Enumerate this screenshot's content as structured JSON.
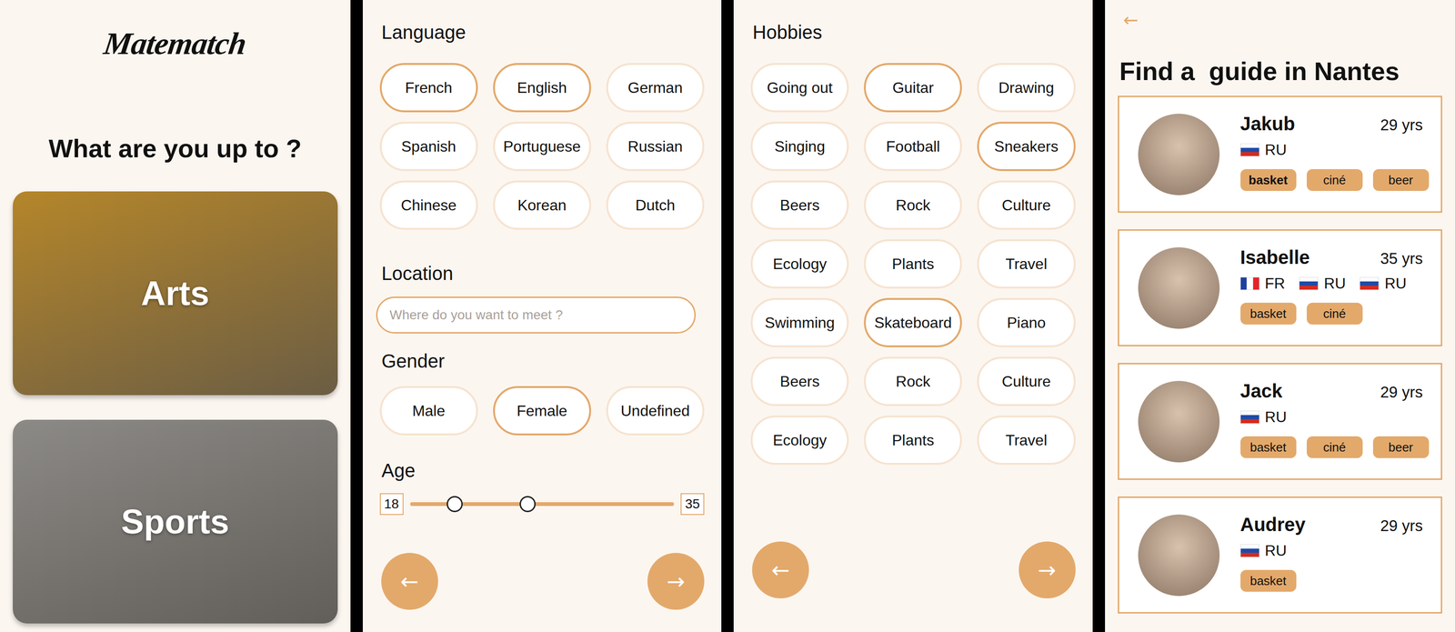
{
  "home": {
    "logo": "Matematch",
    "title": "What are you up to ?",
    "categories": [
      {
        "label": "Arts",
        "color": "#b5862a"
      },
      {
        "label": "Sports",
        "color": "#8c8a86"
      }
    ]
  },
  "filters": {
    "language": {
      "heading": "Language",
      "options": [
        {
          "label": "French",
          "selected": true
        },
        {
          "label": "English",
          "selected": true
        },
        {
          "label": "German",
          "selected": false
        },
        {
          "label": "Spanish",
          "selected": false
        },
        {
          "label": "Portuguese",
          "selected": false
        },
        {
          "label": "Russian",
          "selected": false
        },
        {
          "label": "Chinese",
          "selected": false
        },
        {
          "label": "Korean",
          "selected": false
        },
        {
          "label": "Dutch",
          "selected": false
        }
      ]
    },
    "location": {
      "heading": "Location",
      "placeholder": "Where do you want to meet ?"
    },
    "gender": {
      "heading": "Gender",
      "options": [
        {
          "label": "Male",
          "selected": false
        },
        {
          "label": "Female",
          "selected": true
        },
        {
          "label": "Undefined",
          "selected": false
        }
      ]
    },
    "age": {
      "heading": "Age",
      "min": "18",
      "max": "35",
      "low_level": 0.17,
      "high_level": 0.446
    },
    "nav": {
      "back": "←",
      "next": "→"
    }
  },
  "hobbies": {
    "heading": "Hobbies",
    "options": [
      {
        "label": "Going out",
        "selected": false
      },
      {
        "label": "Guitar",
        "selected": true
      },
      {
        "label": "Drawing",
        "selected": false
      },
      {
        "label": "Singing",
        "selected": false
      },
      {
        "label": "Football",
        "selected": false
      },
      {
        "label": "Sneakers",
        "selected": true
      },
      {
        "label": "Beers",
        "selected": false
      },
      {
        "label": "Rock",
        "selected": false
      },
      {
        "label": "Culture",
        "selected": false
      },
      {
        "label": "Ecology",
        "selected": false
      },
      {
        "label": "Plants",
        "selected": false
      },
      {
        "label": "Travel",
        "selected": false
      },
      {
        "label": "Swimming",
        "selected": false
      },
      {
        "label": "Skateboard",
        "selected": true
      },
      {
        "label": "Piano",
        "selected": false
      },
      {
        "label": "Beers",
        "selected": false
      },
      {
        "label": "Rock",
        "selected": false
      },
      {
        "label": "Culture",
        "selected": false
      },
      {
        "label": "Ecology",
        "selected": false
      },
      {
        "label": "Plants",
        "selected": false
      },
      {
        "label": "Travel",
        "selected": false
      }
    ],
    "nav": {
      "back": "←",
      "next": "→"
    }
  },
  "guides": {
    "back": "←",
    "title": "Find a  guide in Nantes",
    "people": [
      {
        "name": "Jakub",
        "age": "29 yrs",
        "languages": [
          "RU"
        ],
        "tags": [
          {
            "label": "basket",
            "highlighted": true
          },
          {
            "label": "ciné",
            "highlighted": false
          },
          {
            "label": "beer",
            "highlighted": false
          }
        ]
      },
      {
        "name": "Isabelle",
        "age": "35 yrs",
        "languages": [
          "FR",
          "RU",
          "RU"
        ],
        "tags": [
          {
            "label": "basket",
            "highlighted": false
          },
          {
            "label": "ciné",
            "highlighted": false
          }
        ]
      },
      {
        "name": "Jack",
        "age": "29 yrs",
        "languages": [
          "RU"
        ],
        "tags": [
          {
            "label": "basket",
            "highlighted": false
          },
          {
            "label": "ciné",
            "highlighted": false
          },
          {
            "label": "beer",
            "highlighted": false
          }
        ]
      },
      {
        "name": "Audrey",
        "age": "29 yrs",
        "languages": [
          "RU"
        ],
        "tags": [
          {
            "label": "basket",
            "highlighted": false
          }
        ]
      }
    ]
  }
}
